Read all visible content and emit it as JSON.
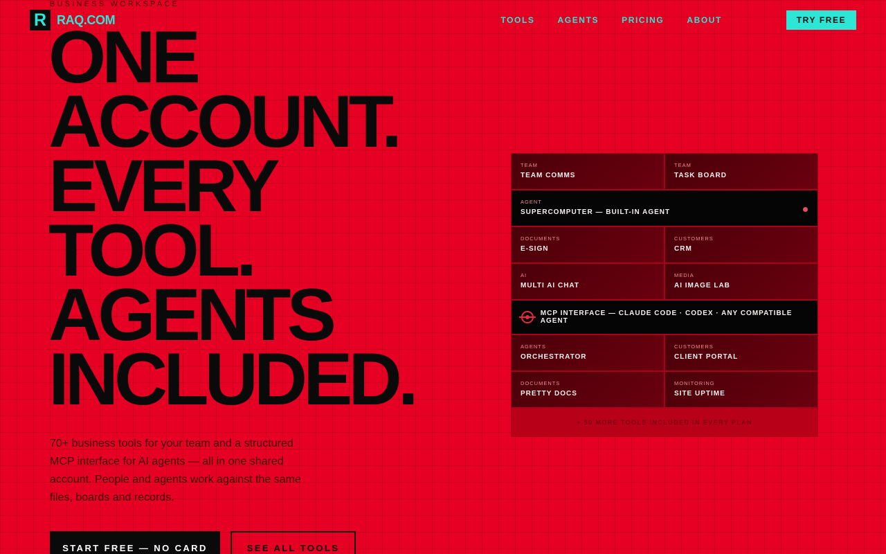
{
  "header": {
    "eyebrow": "BUSINESS WORKSPACE",
    "logo_mark": "R",
    "logo_text": "RAQ.COM",
    "nav": [
      "TOOLS",
      "AGENTS",
      "PRICING",
      "ABOUT"
    ],
    "cta": "TRY FREE"
  },
  "hero": {
    "title_lines": [
      "ONE",
      "ACCOUNT.",
      "EVERY",
      "TOOL.",
      "AGENTS",
      "INCLUDED."
    ],
    "description": "70+ business tools for your team and a structured MCP interface for AI agents — all in one shared account. People and agents work against the same files, boards and records.",
    "primary_button": "START FREE — NO CARD",
    "secondary_button": "SEE ALL TOOLS"
  },
  "tools": {
    "row1": [
      {
        "category": "TEAM",
        "name": "TEAM COMMS"
      },
      {
        "category": "TEAM",
        "name": "TASK BOARD"
      }
    ],
    "agent": {
      "category": "AGENT",
      "name": "SUPERCOMPUTER — BUILT-IN AGENT"
    },
    "row3": [
      {
        "category": "DOCUMENTS",
        "name": "E-SIGN"
      },
      {
        "category": "CUSTOMERS",
        "name": "CRM"
      }
    ],
    "row4": [
      {
        "category": "AI",
        "name": "MULTI AI CHAT"
      },
      {
        "category": "MEDIA",
        "name": "AI IMAGE LAB"
      }
    ],
    "mcp": "MCP INTERFACE — CLAUDE CODE · CODEX · ANY COMPATIBLE AGENT",
    "row6": [
      {
        "category": "AGENTS",
        "name": "ORCHESTRATOR"
      },
      {
        "category": "CUSTOMERS",
        "name": "CLIENT PORTAL"
      }
    ],
    "row7": [
      {
        "category": "DOCUMENTS",
        "name": "PRETTY DOCS"
      },
      {
        "category": "MONITORING",
        "name": "SITE UPTIME"
      }
    ],
    "more": "+ 50 MORE TOOLS INCLUDED IN EVERY PLAN"
  },
  "colors": {
    "background": "#e60023",
    "accent": "#2ee6d6",
    "ink": "#0a0a0a"
  }
}
